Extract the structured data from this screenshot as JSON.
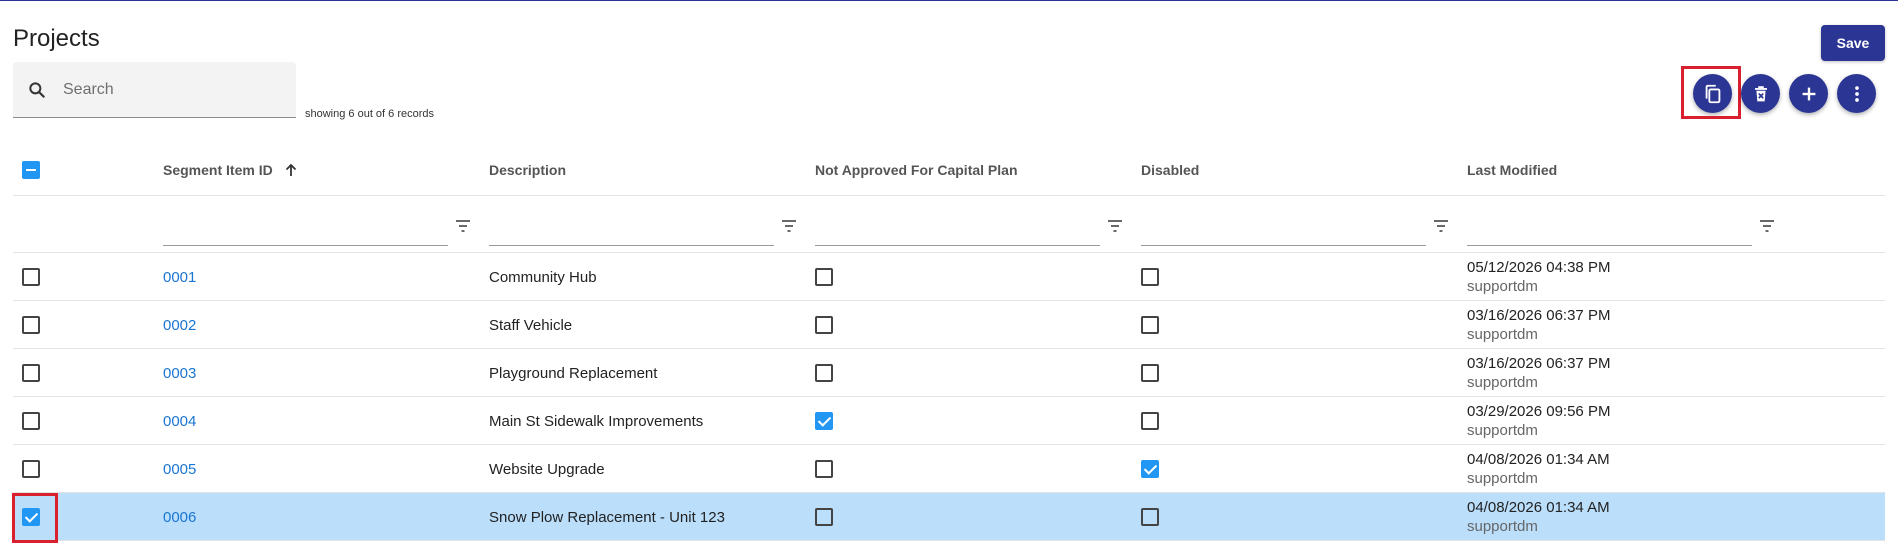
{
  "page": {
    "title": "Projects"
  },
  "toolbar": {
    "save_label": "Save",
    "icons": [
      "copy-icon",
      "delete-icon",
      "add-icon",
      "more-vert-icon"
    ]
  },
  "search": {
    "placeholder": "Search",
    "value": "",
    "records_text": "showing 6 out of 6 records"
  },
  "colors": {
    "primary": "#2b3593",
    "link": "#1976d2",
    "checkbox": "#2196f3",
    "selected_row": "#bbdefb",
    "highlight": "#d9202f"
  },
  "table": {
    "columns": [
      "Segment Item ID",
      "Description",
      "Not Approved For Capital Plan",
      "Disabled",
      "Last Modified"
    ],
    "sort": {
      "column": "Segment Item ID",
      "direction": "ascending"
    },
    "header_select": "indeterminate",
    "rows": [
      {
        "selected": false,
        "id": "0001",
        "description": "Community Hub",
        "not_approved": false,
        "disabled": false,
        "modified": "05/12/2026 04:38 PM",
        "user": "supportdm"
      },
      {
        "selected": false,
        "id": "0002",
        "description": "Staff Vehicle",
        "not_approved": false,
        "disabled": false,
        "modified": "03/16/2026 06:37 PM",
        "user": "supportdm"
      },
      {
        "selected": false,
        "id": "0003",
        "description": "Playground Replacement",
        "not_approved": false,
        "disabled": false,
        "modified": "03/16/2026 06:37 PM",
        "user": "supportdm"
      },
      {
        "selected": false,
        "id": "0004",
        "description": "Main St Sidewalk Improvements",
        "not_approved": true,
        "disabled": false,
        "modified": "03/29/2026 09:56 PM",
        "user": "supportdm"
      },
      {
        "selected": false,
        "id": "0005",
        "description": "Website Upgrade",
        "not_approved": false,
        "disabled": true,
        "modified": "04/08/2026 01:34 AM",
        "user": "supportdm"
      },
      {
        "selected": true,
        "id": "0006",
        "description": "Snow Plow Replacement - Unit 123",
        "not_approved": false,
        "disabled": false,
        "modified": "04/08/2026 01:34 AM",
        "user": "supportdm"
      }
    ]
  }
}
